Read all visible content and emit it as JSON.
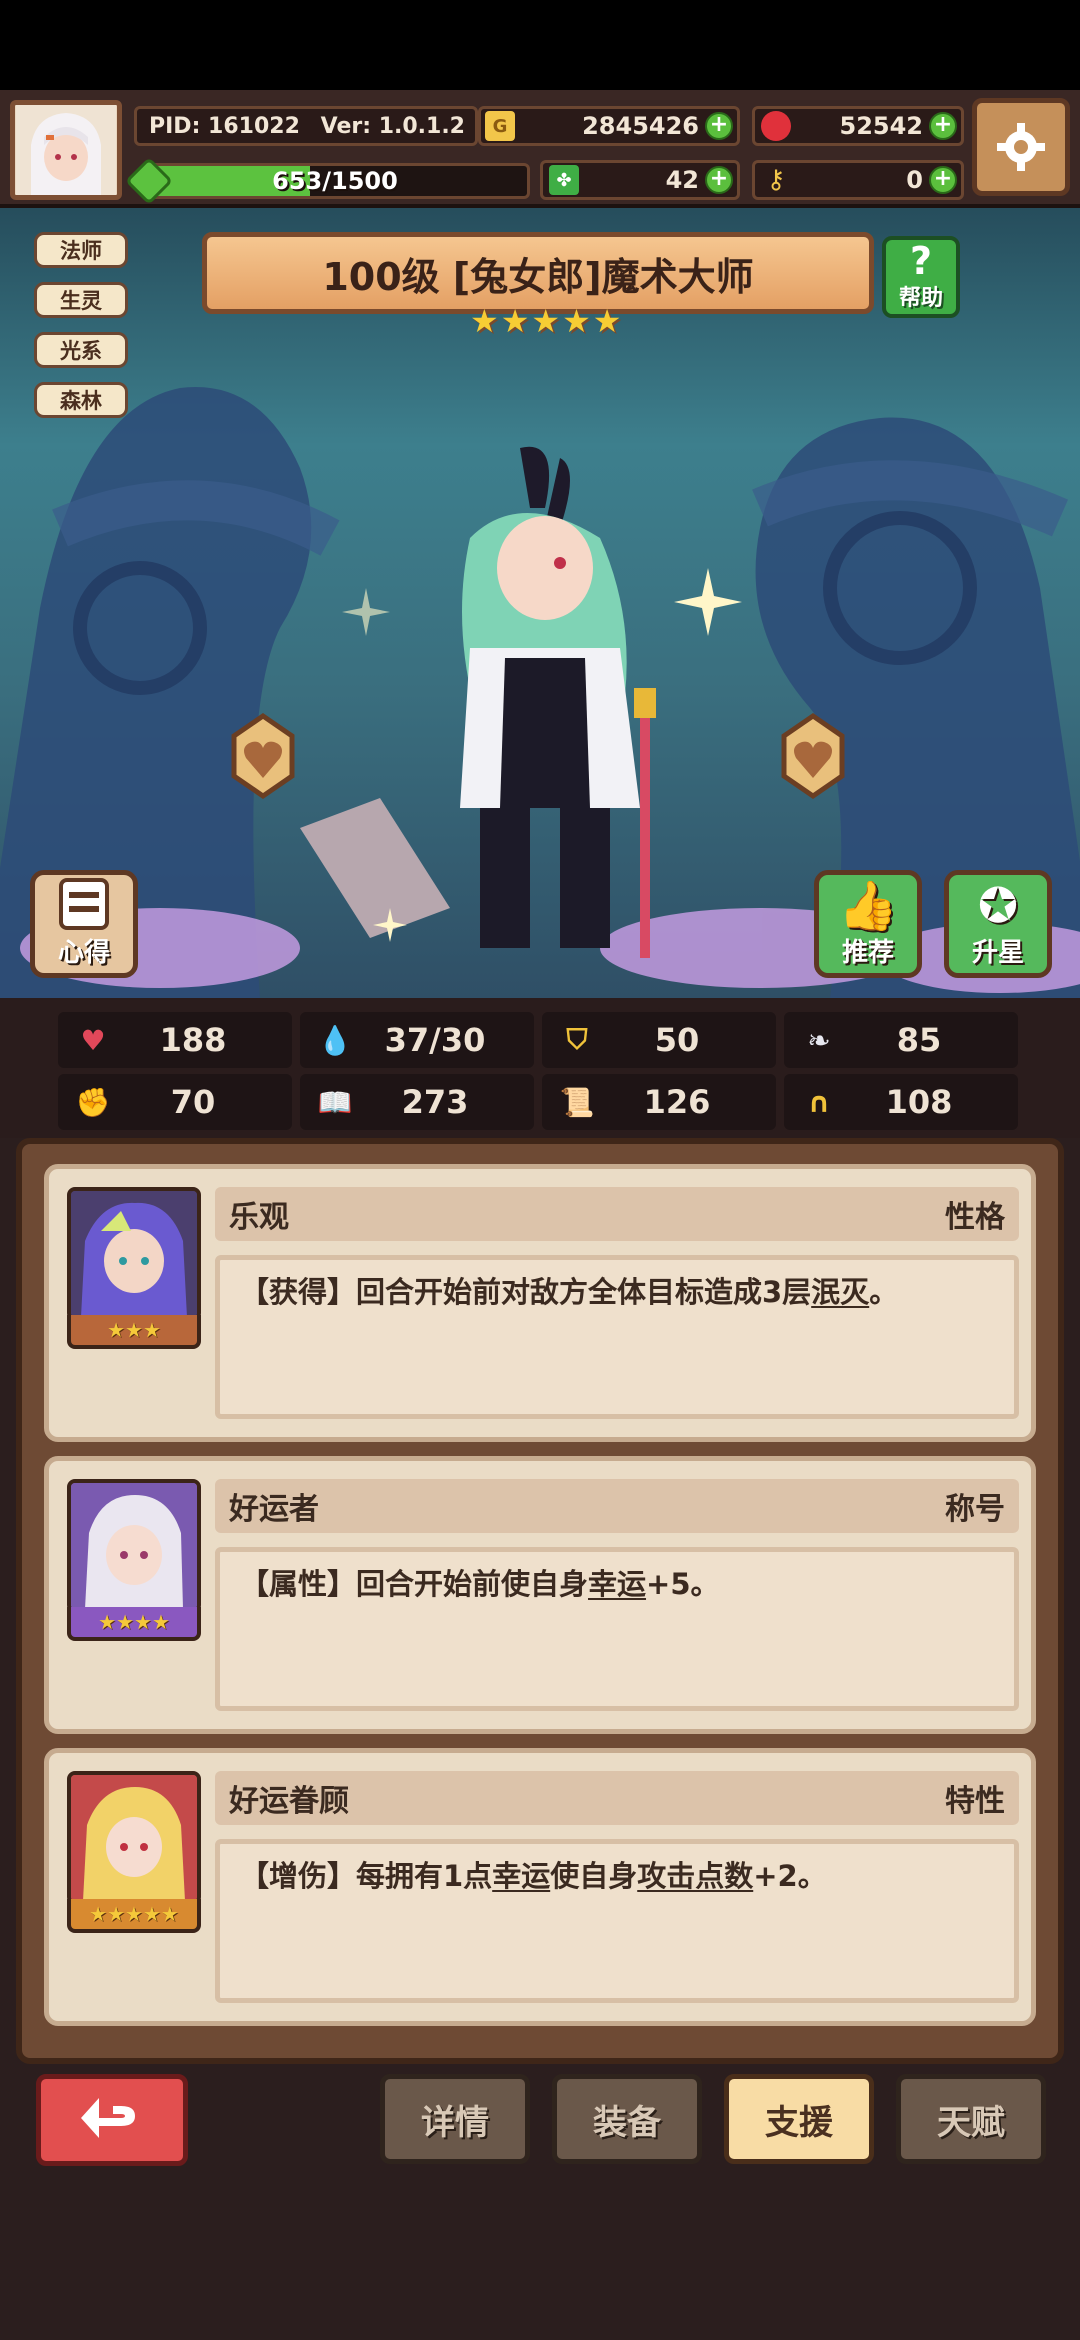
{
  "header": {
    "pid": "PID: 161022",
    "version": "Ver: 1.0.1.2",
    "gold": "2845426",
    "gems": "52542",
    "clover": "42",
    "keys": "0",
    "exp_text": "653/1500",
    "exp_current": 653,
    "exp_max": 1500
  },
  "tags": [
    "法师",
    "生灵",
    "光系",
    "森林"
  ],
  "character": {
    "title": "100级 [兔女郎]魔术大师",
    "stars": 5
  },
  "buttons": {
    "help": "帮助",
    "insight": "心得",
    "recommend": "推荐",
    "star_up": "升星"
  },
  "stats": [
    {
      "icon": "heart-icon",
      "value": "188"
    },
    {
      "icon": "mana-drop-icon",
      "value": "37/30"
    },
    {
      "icon": "shield-icon",
      "value": "50"
    },
    {
      "icon": "wing-icon",
      "value": "85"
    },
    {
      "icon": "fist-icon",
      "value": "70"
    },
    {
      "icon": "spellbook-icon",
      "value": "273"
    },
    {
      "icon": "scroll-icon",
      "value": "126"
    },
    {
      "icon": "horseshoe-icon",
      "value": "108"
    }
  ],
  "cards": [
    {
      "name": "乐观",
      "type": "性格",
      "desc_prefix": "【获得】回合开始前对敌方全体目标造成3层",
      "desc_link": "泯灭",
      "desc_suffix": "。",
      "stars": 3
    },
    {
      "name": "好运者",
      "type": "称号",
      "desc_prefix": "【属性】回合开始前使自身",
      "desc_link": "幸运",
      "desc_suffix": "+5。",
      "stars": 4
    },
    {
      "name": "好运眷顾",
      "type": "特性",
      "desc_prefix": "【增伤】每拥有1点",
      "desc_link": "幸运",
      "desc_mid": "使自身",
      "desc_link2": "攻击点数",
      "desc_suffix": "+2。",
      "stars": 5
    }
  ],
  "nav": {
    "details": "详情",
    "equipment": "装备",
    "support": "支援",
    "talent": "天赋"
  },
  "colors": {
    "accent_green": "#5cc23f",
    "active_tab": "#f8dca5",
    "back_red": "#e24f4f"
  }
}
